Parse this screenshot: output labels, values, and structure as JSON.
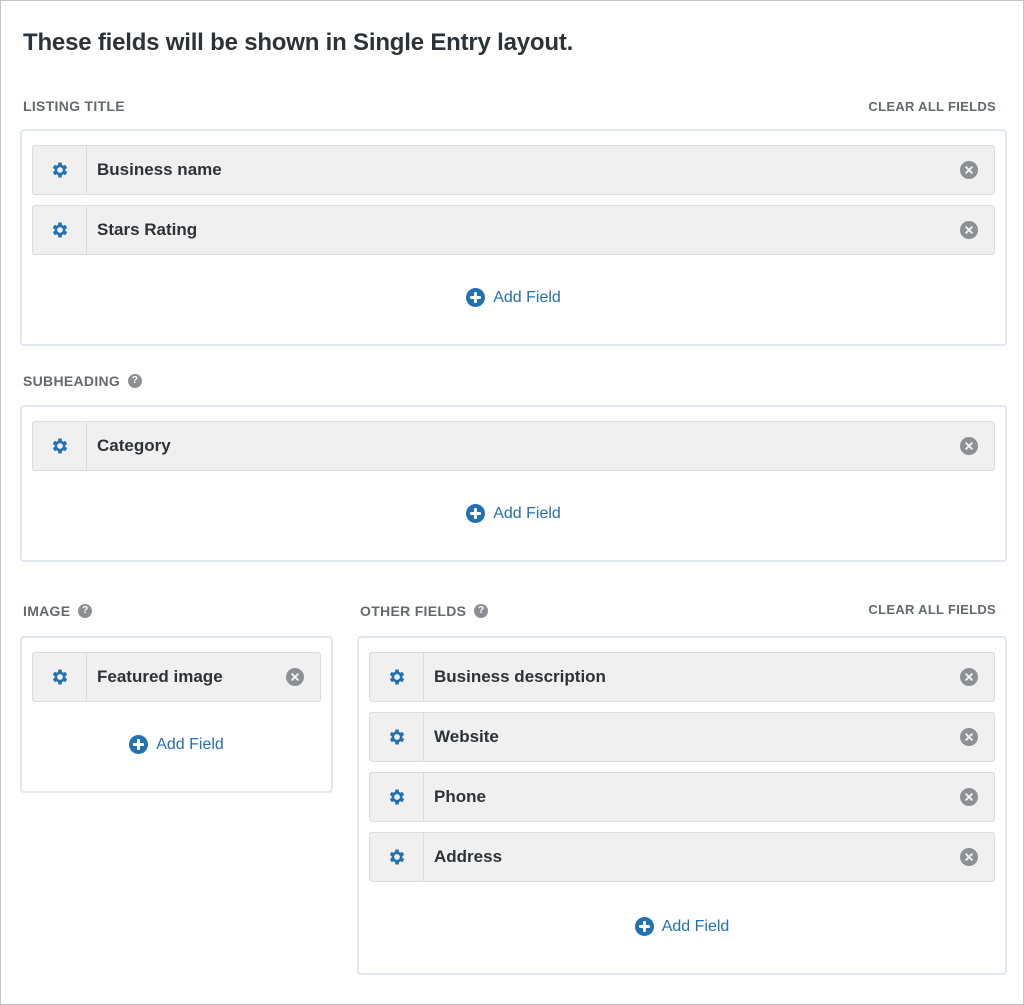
{
  "page": {
    "title": "These fields will be shown in Single Entry layout."
  },
  "sections": {
    "listing_title": {
      "label": "LISTING TITLE",
      "clear_label": "CLEAR ALL FIELDS",
      "fields": [
        "Business name",
        "Stars Rating"
      ],
      "add_label": "Add Field"
    },
    "subheading": {
      "label": "SUBHEADING",
      "fields": [
        "Category"
      ],
      "add_label": "Add Field"
    },
    "image": {
      "label": "IMAGE",
      "fields": [
        "Featured image"
      ],
      "add_label": "Add Field"
    },
    "other_fields": {
      "label": "OTHER FIELDS",
      "clear_label": "CLEAR ALL FIELDS",
      "fields": [
        "Business description",
        "Website",
        "Phone",
        "Address"
      ],
      "add_label": "Add Field"
    }
  },
  "icons": {
    "gear": "gear-icon",
    "remove": "remove-circle-icon",
    "add": "plus-circle-icon",
    "help": "help-icon"
  },
  "colors": {
    "accent": "#2271b1",
    "label": "#646970",
    "field_bg": "#f0f0f1",
    "area_border": "#e1e7f0"
  }
}
